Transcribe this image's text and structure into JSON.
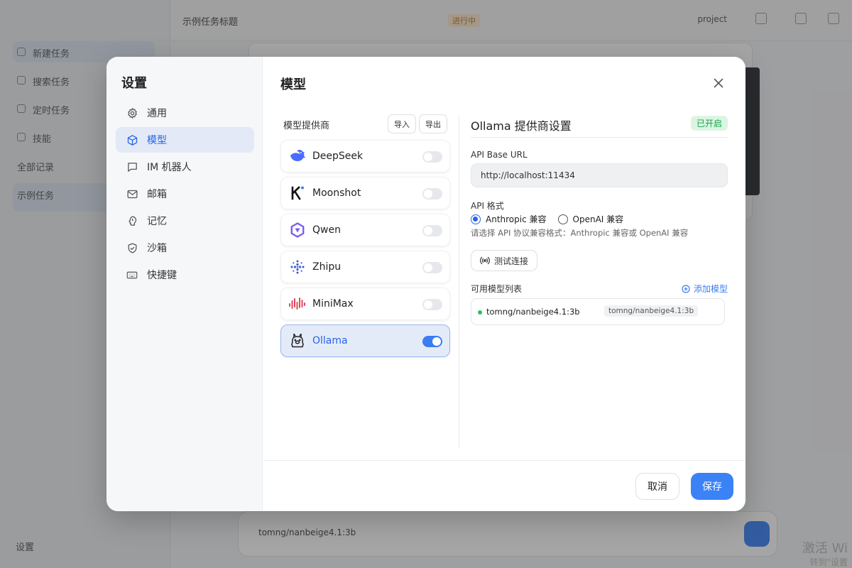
{
  "background": {
    "sidebar_items": [
      "新建任务",
      "搜索任务",
      "定时任务",
      "技能",
      "全部记录",
      "示例任务"
    ],
    "topbar_title": "示例任务标题",
    "topbar_tag": "进行中",
    "project_label": "project",
    "input_model": "tomng/nanbeige4.1:3b",
    "settings_label": "设置",
    "watermark_line1": "激活 Wi",
    "watermark_line2": "转到\"设置"
  },
  "dialog": {
    "title": "设置",
    "nav": [
      {
        "label": "通用",
        "icon": "gear-icon"
      },
      {
        "label": "模型",
        "icon": "cube-icon"
      },
      {
        "label": "IM 机器人",
        "icon": "chat-bubble-icon"
      },
      {
        "label": "邮箱",
        "icon": "mail-icon"
      },
      {
        "label": "记忆",
        "icon": "brain-icon"
      },
      {
        "label": "沙箱",
        "icon": "shield-icon"
      },
      {
        "label": "快捷键",
        "icon": "keyboard-icon"
      }
    ],
    "main_title": "模型",
    "providers_heading": "模型提供商",
    "import_label": "导入",
    "export_label": "导出",
    "providers": [
      {
        "name": "DeepSeek",
        "icon": "deepseek-logo-icon",
        "enabled": false
      },
      {
        "name": "Moonshot",
        "icon": "moonshot-logo-icon",
        "enabled": false
      },
      {
        "name": "Qwen",
        "icon": "qwen-logo-icon",
        "enabled": false
      },
      {
        "name": "Zhipu",
        "icon": "zhipu-logo-icon",
        "enabled": false
      },
      {
        "name": "MiniMax",
        "icon": "minimax-logo-icon",
        "enabled": false
      },
      {
        "name": "Ollama",
        "icon": "ollama-logo-icon",
        "enabled": true
      }
    ],
    "detail": {
      "title": "Ollama 提供商设置",
      "status_badge": "已开启",
      "base_url_label": "API Base URL",
      "base_url_value": "http://localhost:11434",
      "format_label": "API 格式",
      "format_options": [
        "Anthropic 兼容",
        "OpenAI 兼容"
      ],
      "format_selected": "Anthropic 兼容",
      "format_hint": "请选择 API 协议兼容格式：Anthropic 兼容或 OpenAI 兼容",
      "test_button": "测试连接",
      "models_label": "可用模型列表",
      "add_model": "添加模型",
      "models": [
        {
          "name": "tomng/nanbeige4.1:3b",
          "tag": "tomng/nanbeige4.1:3b",
          "status_color": "#22c55e"
        }
      ]
    },
    "cancel_label": "取消",
    "save_label": "保存"
  },
  "colors": {
    "accent": "#3b82f6",
    "active_nav_bg": "#e3e9f6",
    "success": "#16a34a"
  }
}
